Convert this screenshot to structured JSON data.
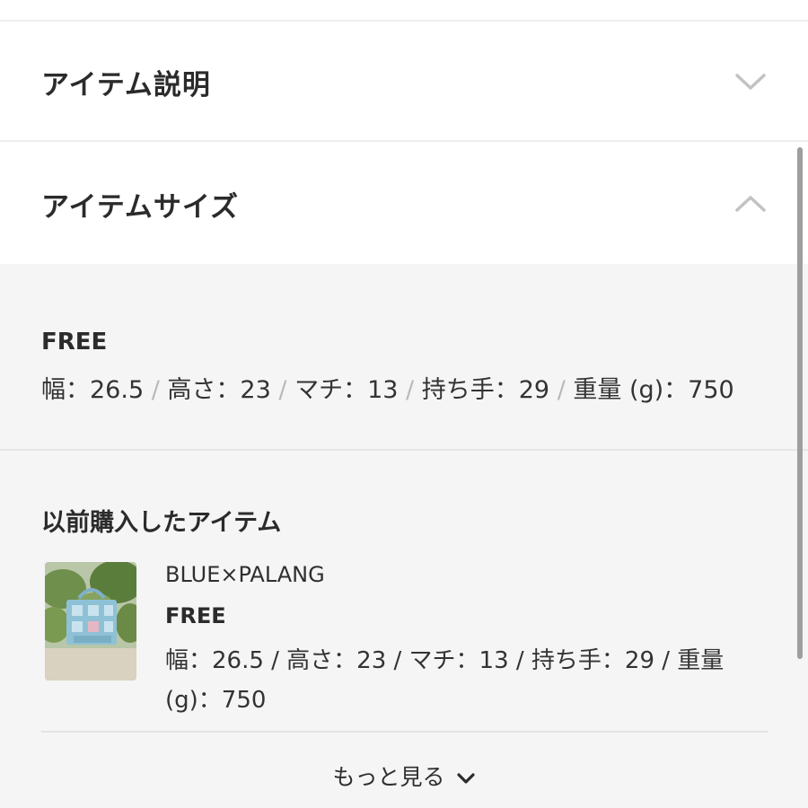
{
  "accordion": {
    "description": {
      "title": "アイテム説明",
      "state": "collapsed",
      "icon": "chevron-down-icon"
    },
    "size": {
      "title": "アイテムサイズ",
      "state": "expanded",
      "icon": "chevron-up-icon"
    }
  },
  "size_info": {
    "size_name": "FREE",
    "specs": [
      {
        "label": "幅：26.5"
      },
      {
        "label": "高さ：23"
      },
      {
        "label": "マチ：13"
      },
      {
        "label": "持ち手：29"
      },
      {
        "label": "重量 (g)：750"
      }
    ],
    "separator": "/"
  },
  "previous_purchase": {
    "title": "以前購入したアイテム",
    "item": {
      "brand": "BLUE×PALANG",
      "size_name": "FREE",
      "spec_text": "幅：26.5 / 高さ：23 / マチ：13 / 持ち手：29 / 重量(g)：750"
    }
  },
  "more_link": {
    "label": "もっと見る",
    "icon": "chevron-down-icon"
  },
  "colors": {
    "panel_bg": "#f5f5f5",
    "text": "#2b2b2b",
    "chevron": "#bdbdbd",
    "separator": "#b8b8b8"
  }
}
